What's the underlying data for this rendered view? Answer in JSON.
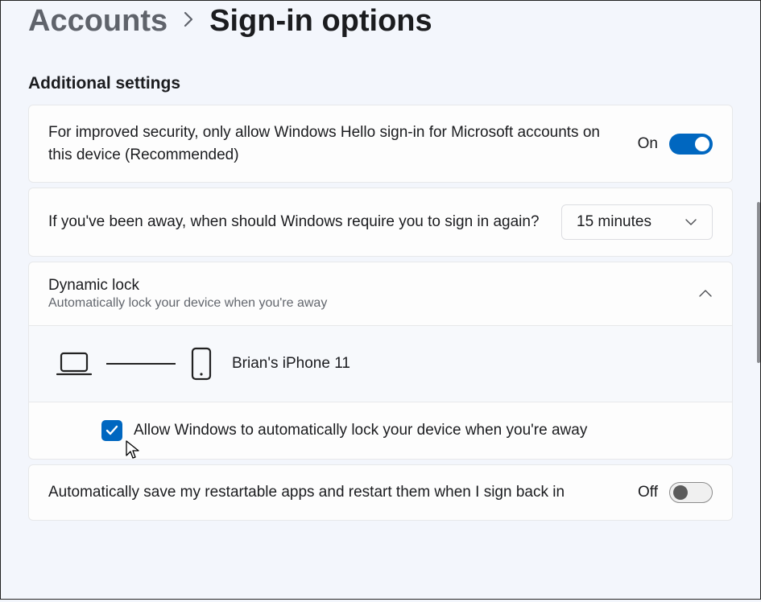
{
  "breadcrumb": {
    "parent": "Accounts",
    "current": "Sign-in options"
  },
  "section_heading": "Additional settings",
  "windows_hello": {
    "text": "For improved security, only allow Windows Hello sign-in for Microsoft accounts on this device (Recommended)",
    "state_label": "On",
    "state": true
  },
  "require_signin": {
    "text": "If you've been away, when should Windows require you to sign in again?",
    "selected": "15 minutes"
  },
  "dynamic_lock": {
    "title": "Dynamic lock",
    "subtitle": "Automatically lock your device when you're away",
    "expanded": true,
    "device_name": "Brian's iPhone 11",
    "checkbox_label": "Allow Windows to automatically lock your device when you're away",
    "checkbox_checked": true
  },
  "auto_restart": {
    "text": "Automatically save my restartable apps and restart them when I sign back in",
    "state_label": "Off",
    "state": false
  }
}
